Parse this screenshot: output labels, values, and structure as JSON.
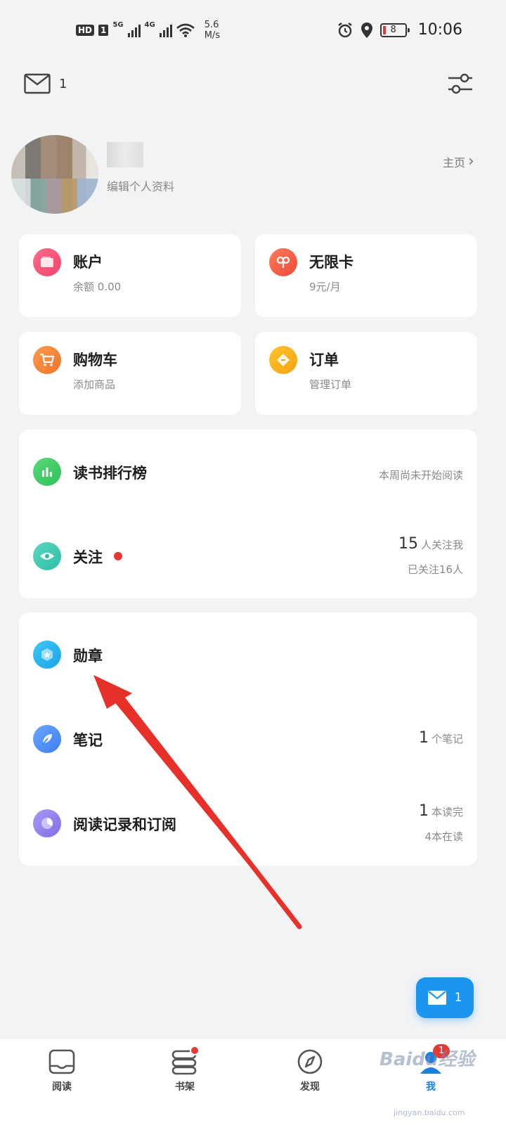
{
  "status_bar": {
    "hd": "HD",
    "sim": "1",
    "net5g": "5G",
    "net4g": "4G",
    "speed_value": "5.6",
    "speed_unit": "M/s",
    "battery": "8",
    "time": "10:06"
  },
  "topbar": {
    "mail_count": "1"
  },
  "profile": {
    "edit_label": "编辑个人资料",
    "homepage_label": "主页",
    "chevron": "›"
  },
  "cards": {
    "account": {
      "title": "账户",
      "subtitle": "余额 0.00"
    },
    "unlimited": {
      "title": "无限卡",
      "subtitle": "9元/月"
    },
    "cart": {
      "title": "购物车",
      "subtitle": "添加商品"
    },
    "orders": {
      "title": "订单",
      "subtitle": "管理订单"
    }
  },
  "ranking": {
    "title": "读书排行榜",
    "status": "本周尚未开始阅读"
  },
  "follow": {
    "title": "关注",
    "followers_num": "15",
    "followers_label": "人关注我",
    "following": "已关注16人"
  },
  "medals": {
    "title": "勋章"
  },
  "notes": {
    "title": "笔记",
    "count": "1",
    "count_label": "个笔记"
  },
  "history": {
    "title": "阅读记录和订阅",
    "finished_num": "1",
    "finished_label": "本读完",
    "reading": "4本在读"
  },
  "fab": {
    "count": "1"
  },
  "nav": {
    "read": "阅读",
    "shelf": "书架",
    "discover": "发现",
    "me": "我",
    "me_badge": "1"
  },
  "watermark": {
    "text": "Baidu经验",
    "sub": "jingyan.baidu.com"
  },
  "colors": {
    "background": "#f2f3f5",
    "accent_blue": "#1a96f0",
    "badge_red": "#e53935",
    "arrow_red": "#e8302a"
  }
}
